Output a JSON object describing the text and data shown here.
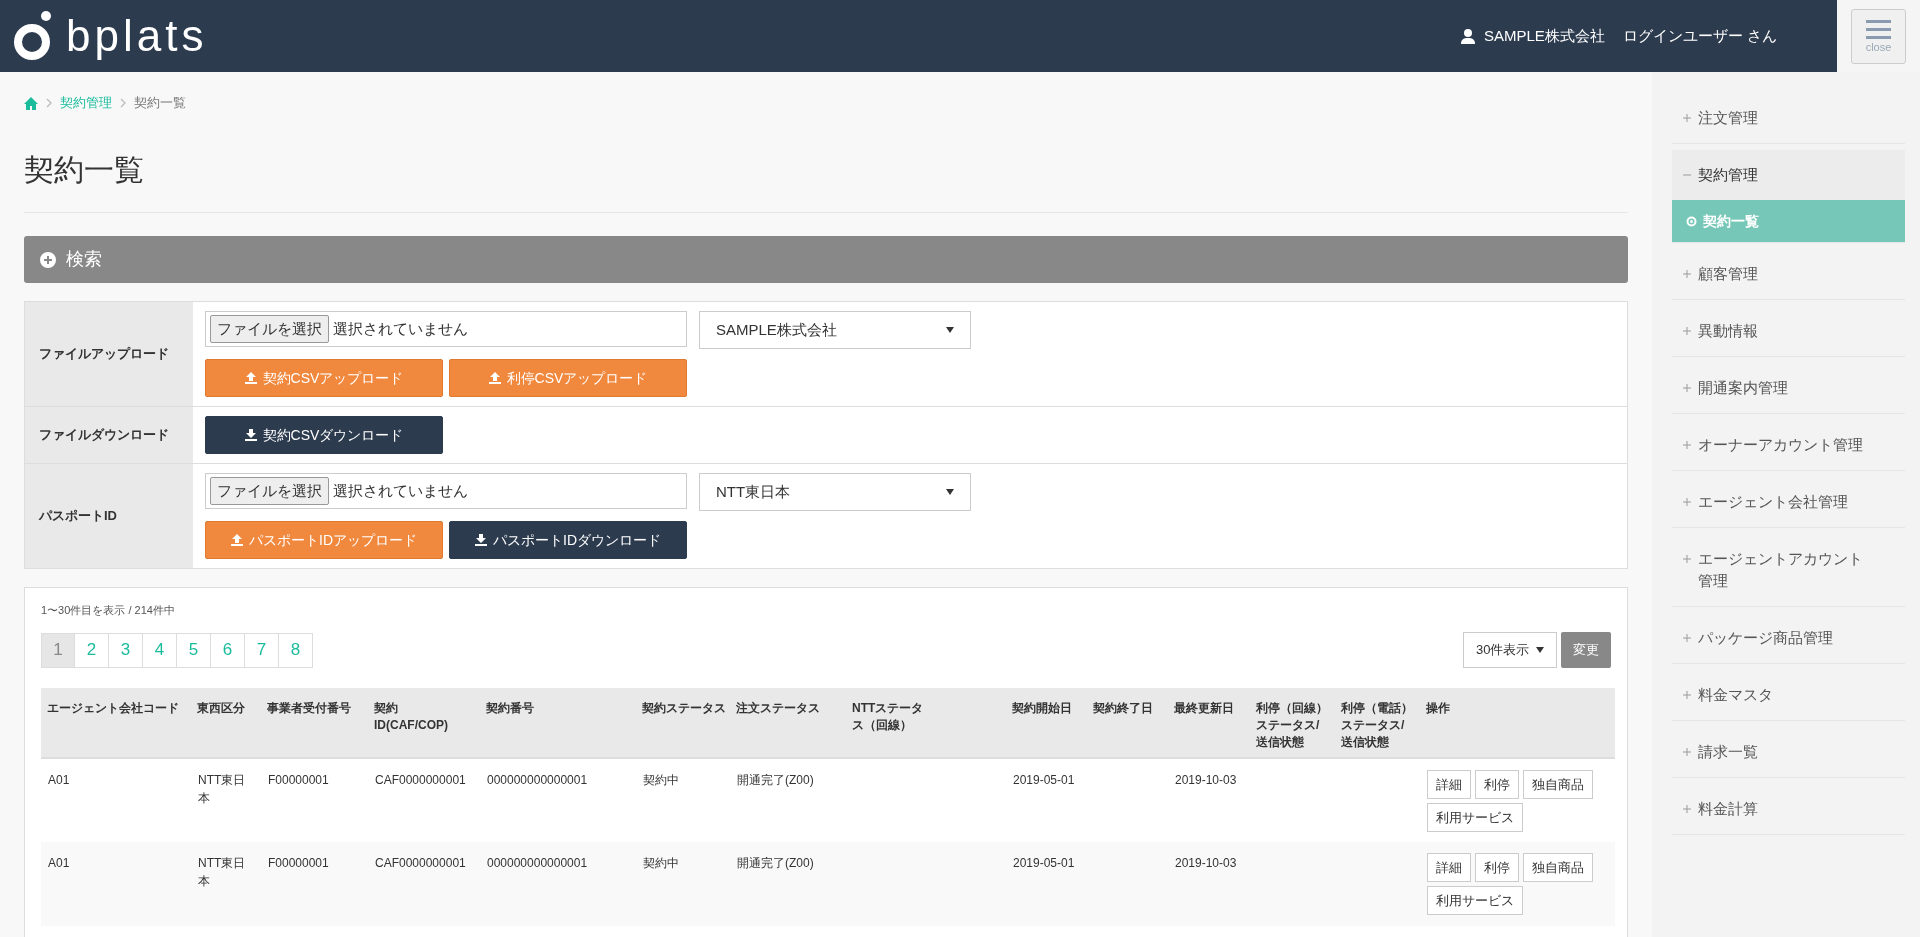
{
  "header": {
    "logo": "bplats",
    "company": "SAMPLE株式会社",
    "user": "ログインユーザー さん",
    "menu_button": "close"
  },
  "breadcrumb": [
    {
      "label": "契約管理",
      "kind": "link"
    },
    {
      "label": "契約一覧",
      "kind": "current"
    }
  ],
  "page_title": "契約一覧",
  "search_panel": {
    "title": "検索",
    "expanded": false
  },
  "upload_form": [
    {
      "label": "ファイルアップロード",
      "controls": [
        {
          "kind": "file",
          "button": "ファイルを選択",
          "value": "選択されていません"
        },
        {
          "kind": "select",
          "value": "SAMPLE株式会社"
        },
        {
          "kind": "break"
        },
        {
          "kind": "upload",
          "label": "契約CSVアップロード"
        },
        {
          "kind": "upload",
          "label": "利停CSVアップロード"
        }
      ]
    },
    {
      "label": "ファイルダウンロード",
      "controls": [
        {
          "kind": "download",
          "label": "契約CSVダウンロード"
        }
      ]
    },
    {
      "label": "パスポートID",
      "controls": [
        {
          "kind": "file",
          "button": "ファイルを選択",
          "value": "選択されていません"
        },
        {
          "kind": "select",
          "value": "NTT東日本"
        },
        {
          "kind": "break"
        },
        {
          "kind": "upload",
          "label": "パスポートIDアップロード"
        },
        {
          "kind": "download",
          "label": "パスポートIDダウンロード"
        }
      ]
    }
  ],
  "results": {
    "summary": "1〜30件目を表示 / 214件中",
    "pagination": [
      {
        "label": "1",
        "selected": true
      },
      {
        "label": "2",
        "selected": false
      },
      {
        "label": "3",
        "selected": false
      },
      {
        "label": "4",
        "selected": false
      },
      {
        "label": "5",
        "selected": false
      },
      {
        "label": "6",
        "selected": false
      },
      {
        "label": "7",
        "selected": false
      },
      {
        "label": "8",
        "selected": false
      }
    ],
    "page_size": "30件表示",
    "change_button": "変更",
    "columns": [
      "エージェント会社コード",
      "東西区分",
      "事業者受付番号",
      "契約ID(CAF/COP)",
      "契約番号",
      "契約ステータス",
      "注文ステータス",
      "NTTステータス（回線）",
      "契約開始日",
      "契約終了日",
      "最終更新日",
      "利停（回線）ステータス/送信状態",
      "利停（電話）ステータス/送信状態",
      "操作"
    ],
    "rows": [
      {
        "cells": [
          "A01",
          "NTT東日本",
          "F00000001",
          "CAF0000000001",
          "000000000000001",
          "契約中",
          "開通完了(Z00)",
          "",
          "2019-05-01",
          "",
          "2019-10-03",
          "",
          ""
        ],
        "actions": [
          "詳細",
          "利停",
          "独自商品",
          "利用サービス"
        ]
      },
      {
        "cells": [
          "A01",
          "NTT東日本",
          "F00000001",
          "CAF0000000001",
          "000000000000001",
          "契約中",
          "開通完了(Z00)",
          "",
          "2019-05-01",
          "",
          "2019-10-03",
          "",
          ""
        ],
        "actions": [
          "詳細",
          "利停",
          "独自商品",
          "利用サービス"
        ]
      }
    ]
  },
  "sidebar": [
    {
      "label": "注文管理",
      "expanded": false
    },
    {
      "label": "契約管理",
      "expanded": true,
      "children": [
        {
          "label": "契約一覧",
          "selected": true
        }
      ]
    },
    {
      "label": "顧客管理",
      "expanded": false
    },
    {
      "label": "異動情報",
      "expanded": false
    },
    {
      "label": "開通案内管理",
      "expanded": false
    },
    {
      "label": "オーナーアカウント管理",
      "expanded": false
    },
    {
      "label": "エージェント会社管理",
      "expanded": false
    },
    {
      "label": "エージェントアカウント管理",
      "expanded": false
    },
    {
      "label": "パッケージ商品管理",
      "expanded": false
    },
    {
      "label": "料金マスタ",
      "expanded": false
    },
    {
      "label": "請求一覧",
      "expanded": false
    },
    {
      "label": "料金計算",
      "expanded": false
    }
  ]
}
